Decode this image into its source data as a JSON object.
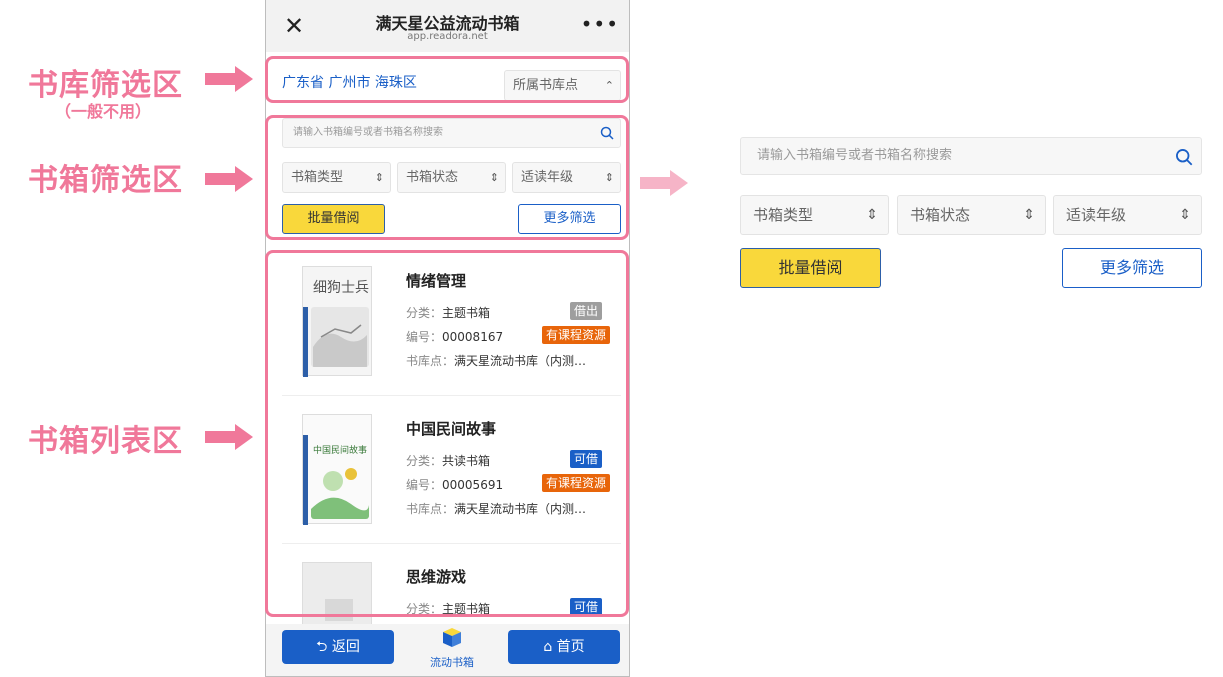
{
  "annotations": {
    "library_filter": "书库筛选区",
    "library_filter_note": "（一般不用）",
    "box_filter": "书箱筛选区",
    "box_list": "书箱列表区"
  },
  "phone": {
    "title": "满天星公益流动书箱",
    "url": "app.readora.net",
    "location": "广东省 广州市 海珠区",
    "library_select": "所属书库点",
    "search_placeholder": "请输入书箱编号或者书箱名称搜索",
    "filters": [
      "书箱类型",
      "书箱状态",
      "适读年级"
    ],
    "batch_borrow": "批量借阅",
    "more_filter": "更多筛选",
    "books": [
      {
        "name": "情绪管理",
        "category_label": "分类：",
        "category": "主题书箱",
        "status": "借出",
        "status_color": "#9e9e9e",
        "id_label": "编号：",
        "id": "00008167",
        "resource": "有课程资源",
        "library_label": "书库点：",
        "library": "满天星流动书库（内测…",
        "cover_text": "细狗士兵"
      },
      {
        "name": "中国民间故事",
        "category_label": "分类：",
        "category": "共读书箱",
        "status": "可借",
        "status_color": "#1a5fc7",
        "id_label": "编号：",
        "id": "00005691",
        "resource": "有课程资源",
        "library_label": "书库点：",
        "library": "满天星流动书库（内测…",
        "cover_text": "中国民间故事"
      },
      {
        "name": "思维游戏",
        "category_label": "分类：",
        "category": "主题书箱",
        "status": "可借",
        "status_color": "#1a5fc7"
      }
    ],
    "bottom": {
      "back": "返回",
      "center": "流动书箱",
      "home": "首页"
    }
  },
  "colors": {
    "annotation": "#f0789a",
    "accent": "#1a5fc7",
    "resource_badge": "#e8650a",
    "yellow": "#f9d83b"
  }
}
